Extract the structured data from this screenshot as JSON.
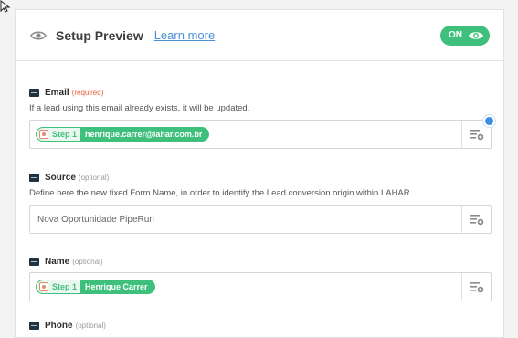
{
  "header": {
    "title": "Setup Preview",
    "learn_more": "Learn more",
    "toggle_label": "ON"
  },
  "fields": [
    {
      "label": "Email",
      "qualifier": "(required)",
      "help": "If a lead using this email already exists, it will be updated.",
      "pill_step": "Step 1",
      "pill_value": "henrique.carrer@lahar.com.br"
    },
    {
      "label": "Source",
      "qualifier": "(optional)",
      "help": "Define here the new fixed Form Name, in order to identify the Lead conversion origin within LAHAR.",
      "value": "Nova Oportunidade PipeRun"
    },
    {
      "label": "Name",
      "qualifier": "(optional)",
      "pill_step": "Step 1",
      "pill_value": "Henrique Carrer"
    },
    {
      "label": "Phone",
      "qualifier": "(optional)"
    }
  ],
  "colors": {
    "accent_green": "#3ec07c",
    "link_blue": "#4a90d9",
    "required_orange": "#e7623c",
    "app_icon": "#1f3340"
  }
}
